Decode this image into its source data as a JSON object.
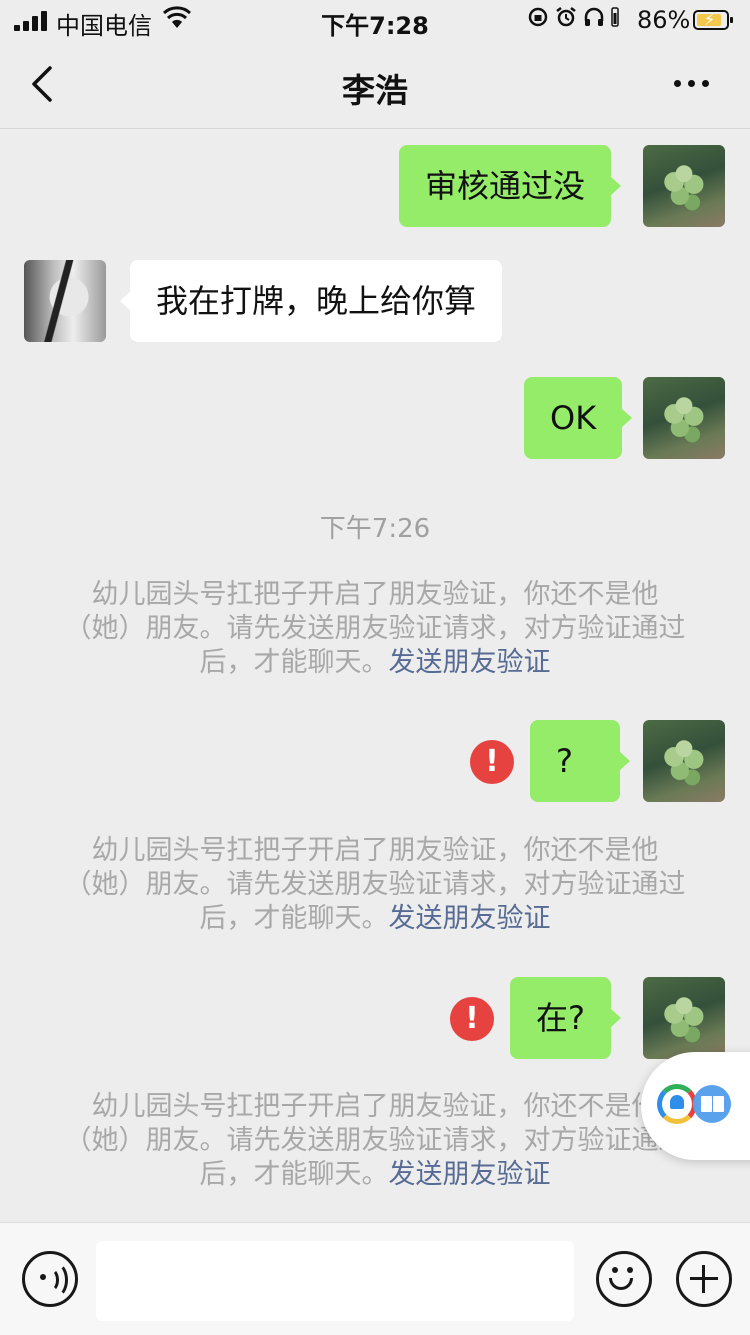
{
  "status_bar": {
    "carrier": "中国电信",
    "time": "下午7:28",
    "battery_percent": "86%",
    "battery_level": 0.86,
    "icons": [
      "signal-icon",
      "wifi-icon",
      "orientation-lock-icon",
      "alarm-icon",
      "headphones-icon",
      "battery-icon"
    ]
  },
  "nav": {
    "title": "李浩",
    "back_icon": "chevron-left-icon",
    "more_icon": "more-icon"
  },
  "messages": {
    "m1": {
      "text": "审核通过没",
      "side": "out"
    },
    "m2": {
      "text": "我在打牌，晚上给你算",
      "side": "in"
    },
    "m3": {
      "text": "OK",
      "side": "out"
    },
    "timestamp": "下午7:26",
    "m4": {
      "text": "?",
      "side": "out",
      "failed": true
    },
    "m5": {
      "text": "在?",
      "side": "out",
      "failed": true
    }
  },
  "system_notice": {
    "text": "幼儿园头号扛把子开启了朋友验证，你还不是他（她）朋友。请先发送朋友验证请求，对方验证通过后，才能聊天。",
    "link": "发送朋友验证"
  },
  "error_mark": "!",
  "input_bar": {
    "voice_icon": "voice-icon",
    "emoji_icon": "emoji-icon",
    "plus_icon": "plus-icon",
    "input_value": ""
  },
  "colors": {
    "background": "#ededed",
    "outgoing_bubble": "#95ec69",
    "incoming_bubble": "#ffffff",
    "error": "#e64340",
    "link": "#576b95"
  }
}
